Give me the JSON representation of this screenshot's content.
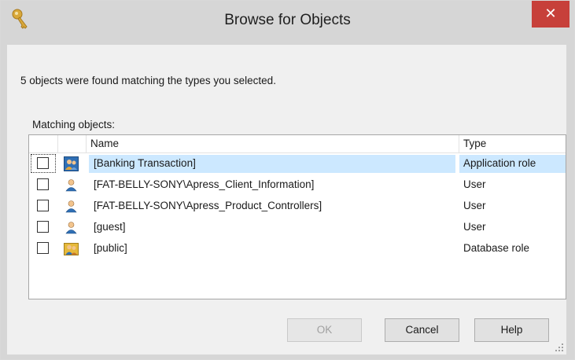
{
  "window": {
    "title": "Browse for Objects",
    "close_label": "✕"
  },
  "message": "5 objects were found matching the types you selected.",
  "matching_label": "Matching objects:",
  "columns": {
    "name": "Name",
    "type": "Type"
  },
  "rows": [
    {
      "name": "[Banking Transaction]",
      "type": "Application role",
      "icon": "application-role-icon",
      "checked": false,
      "selected": true
    },
    {
      "name": "[FAT-BELLY-SONY\\Apress_Client_Information]",
      "type": "User",
      "icon": "user-icon",
      "checked": false,
      "selected": false
    },
    {
      "name": "[FAT-BELLY-SONY\\Apress_Product_Controllers]",
      "type": "User",
      "icon": "user-icon",
      "checked": false,
      "selected": false
    },
    {
      "name": "[guest]",
      "type": "User",
      "icon": "user-icon",
      "checked": false,
      "selected": false
    },
    {
      "name": "[public]",
      "type": "Database role",
      "icon": "database-role-icon",
      "checked": false,
      "selected": false
    }
  ],
  "buttons": {
    "ok": "OK",
    "cancel": "Cancel",
    "help": "Help"
  },
  "colors": {
    "close": "#c7403a",
    "selection": "#cce8ff"
  }
}
